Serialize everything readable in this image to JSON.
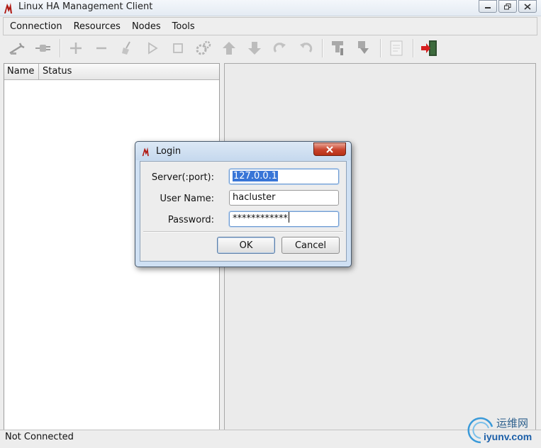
{
  "window": {
    "title": "Linux HA Management Client"
  },
  "menu": [
    "Connection",
    "Resources",
    "Nodes",
    "Tools"
  ],
  "toolbar": {
    "icons": [
      "connect-icon",
      "disconnect-icon",
      "add-icon",
      "remove-icon",
      "cleanup-icon",
      "start-icon",
      "stop-icon",
      "settings-icon",
      "move-up-icon",
      "move-down-icon",
      "redo-icon",
      "undo-icon",
      "standby-icon",
      "active-icon",
      "document-icon",
      "exit-icon"
    ],
    "exit_color": "#d62020"
  },
  "tree": {
    "headers": [
      "Name",
      "Status"
    ]
  },
  "status": {
    "text": "Not Connected"
  },
  "dialog": {
    "title": "Login",
    "server_label": "Server(:port):",
    "server_value": "127.0.0.1",
    "user_label": "User Name:",
    "user_value": "hacluster",
    "password_label": "Password:",
    "password_value": "************",
    "ok_label": "OK",
    "cancel_label": "Cancel"
  },
  "watermark": {
    "cn": "运维网",
    "en": "iyunv.com"
  }
}
